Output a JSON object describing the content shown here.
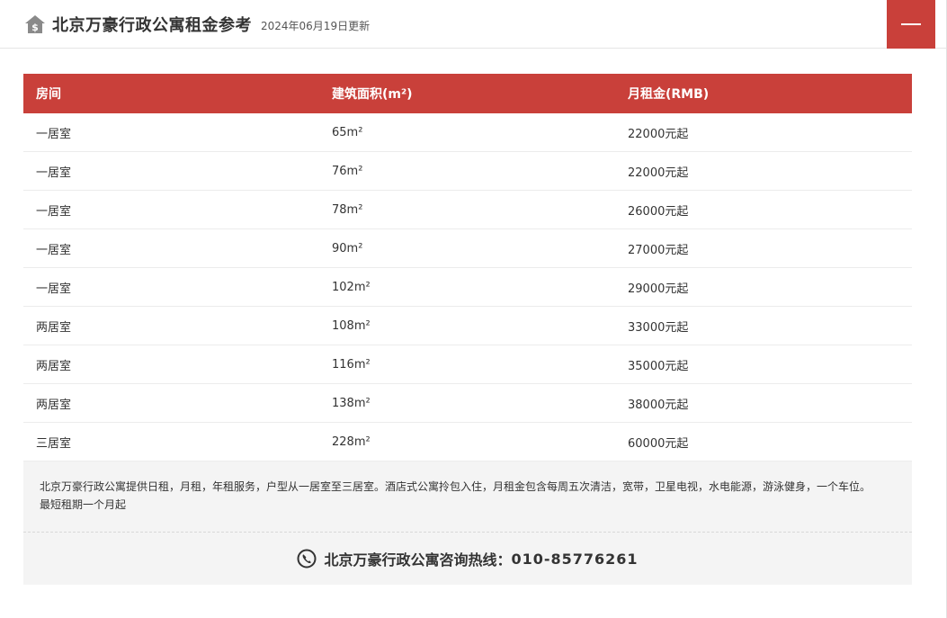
{
  "header": {
    "title": "北京万豪行政公寓租金参考",
    "updated": "2024年06月19日更新",
    "icon": "house-dollar-icon"
  },
  "table": {
    "columns": [
      "房间",
      "建筑面积(m²)",
      "月租金(RMB)"
    ],
    "rows": [
      [
        "一居室",
        "65m²",
        "22000元起"
      ],
      [
        "一居室",
        "76m²",
        "22000元起"
      ],
      [
        "一居室",
        "78m²",
        "26000元起"
      ],
      [
        "一居室",
        "90m²",
        "27000元起"
      ],
      [
        "一居室",
        "102m²",
        "29000元起"
      ],
      [
        "两居室",
        "108m²",
        "33000元起"
      ],
      [
        "两居室",
        "116m²",
        "35000元起"
      ],
      [
        "两居室",
        "138m²",
        "38000元起"
      ],
      [
        "三居室",
        "228m²",
        "60000元起"
      ]
    ]
  },
  "notes": {
    "line1": "北京万豪行政公寓提供日租，月租，年租服务，户型从一居室至三居室。酒店式公寓拎包入住，月租金包含每周五次清洁，宽带，卫星电视，水电能源，游泳健身，一个车位。",
    "line2": "最短租期一个月起"
  },
  "hotline": {
    "label": "北京万豪行政公寓咨询热线：",
    "number": "010-85776261",
    "icon": "phone-icon"
  },
  "colors": {
    "accent": "#c9403a",
    "panel": "#f4f4f4"
  }
}
